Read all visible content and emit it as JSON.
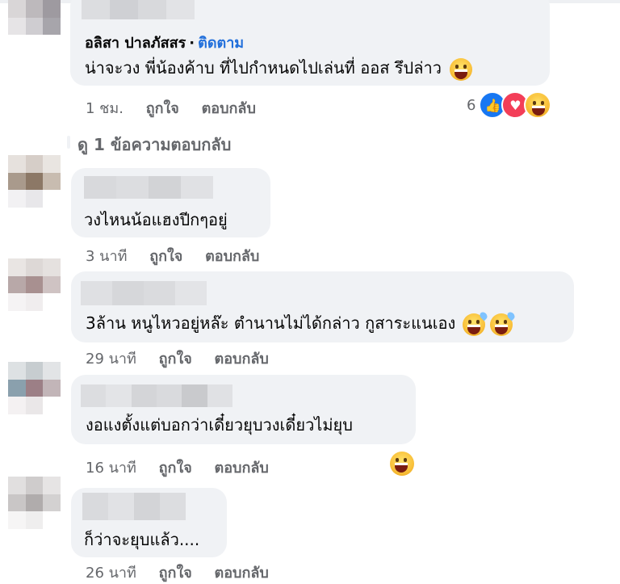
{
  "colors": {
    "bubble": "#f0f2f5",
    "meta": "#65676b",
    "follow": "#216fdb",
    "like": "#1877f2",
    "love": "#f33e58"
  },
  "comments": [
    {
      "author": "อลิสา ปาลภัสสร",
      "follow_label": "ติดตาม",
      "separator": "·",
      "text": "น่าจะวง พี่น้องค้าบ ที่ไปกำหนดไปเล่นที่ ออส รึปล่าว",
      "time": "1 ชม.",
      "like_label": "ถูกใจ",
      "reply_label": "ตอบกลับ",
      "reaction_count": "6",
      "reaction_icons": [
        "like-icon",
        "love-icon",
        "haha-icon"
      ],
      "inline_emoji": "laughing-tears-emoji"
    },
    {
      "text": "วงไหนน้อแฮงปีกๆอยู่",
      "time": "3 นาที",
      "like_label": "ถูกใจ",
      "reply_label": "ตอบกลับ"
    },
    {
      "text": "3ล้าน หนูไหวอยู่หล๊ะ ตำนานไม่ได้กล่าว กูสาระแนเอง",
      "time": "29 นาที",
      "like_label": "ถูกใจ",
      "reply_label": "ตอบกลับ",
      "inline_emoji": [
        "grin-sweat-emoji",
        "grin-sweat-emoji"
      ]
    },
    {
      "text": "งอแงตั้งแต่บอกว่าเดี๋ยวยุบวงเดี๋ยวไม่ยุบ",
      "time": "16 นาที",
      "like_label": "ถูกใจ",
      "reply_label": "ตอบกลับ",
      "reaction_icons": [
        "haha-icon"
      ]
    },
    {
      "text": "ก็ว่าจะยุบแล้ว....",
      "time": "26 นาที",
      "like_label": "ถูกใจ",
      "reply_label": "ตอบกลับ"
    }
  ],
  "view_replies_label": "ดู 1 ข้อความตอบกลับ"
}
